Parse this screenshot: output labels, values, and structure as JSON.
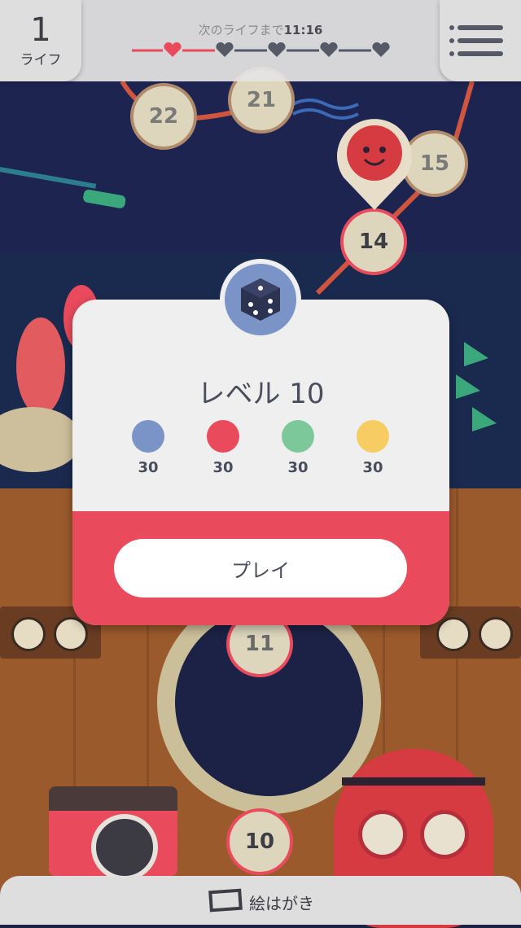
{
  "header": {
    "lives_count": "1",
    "lives_label": "ライフ",
    "timer_prefix": "次のライフまで",
    "timer_value": "11:16",
    "hearts": [
      "filled",
      "empty",
      "empty",
      "empty",
      "empty"
    ]
  },
  "map": {
    "nodes": [
      "22",
      "21",
      "15",
      "14",
      "11",
      "10"
    ]
  },
  "modal": {
    "title": "レベル 10",
    "goals": [
      {
        "color": "#7a94c8",
        "value": "30"
      },
      {
        "color": "#e94b5c",
        "value": "30"
      },
      {
        "color": "#7dc89a",
        "value": "30"
      },
      {
        "color": "#f7cd63",
        "value": "30"
      }
    ],
    "play_label": "プレイ"
  },
  "footer": {
    "postcard_label": "絵はがき"
  },
  "colors": {
    "accent_red": "#e94b5c",
    "text_dark": "#4a4e5c"
  }
}
